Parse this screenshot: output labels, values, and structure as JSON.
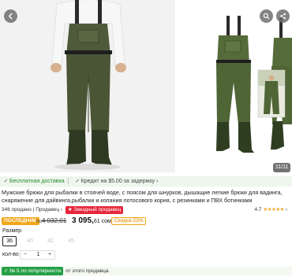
{
  "gallery": {
    "counter": "11/11",
    "back_icon": "chevron-left-icon",
    "search_icon": "search-icon",
    "share_icon": "share-icon"
  },
  "delivery": {
    "free_label": "Бесплатная доставка",
    "guarantee_label": "Кредит на $5.00 за задержку"
  },
  "product": {
    "title": "Мужские брюки для рыбалки в стоячей воде, с поясом для шнурков, дышащие легкие брюки для вадинга, снаряжение для дайвинга,рыбалки и копания лотосового корня, с резинками и ПВХ ботинками",
    "sold": "346 продано",
    "seller_prefix": "Продавец",
    "seller_badge": "Звездный продавец",
    "rating_value": "4.7",
    "rating_stars": "★★★★★"
  },
  "price": {
    "last_badge": "ПОСЛЕДНИЕ",
    "old_prefix": "по",
    "old_price": "4 032,01",
    "new_price_main": "3 095,",
    "new_price_cents": "61 ",
    "currency": "сом",
    "discount": "Скидка 23%"
  },
  "size": {
    "label": "Размер",
    "options": [
      "36",
      "40",
      "42",
      "45"
    ],
    "selected": "36"
  },
  "quantity": {
    "label": "кол-во",
    "minus": "−",
    "value": "1",
    "plus": "+"
  },
  "popular": {
    "badge": "№ 5 по популярности",
    "text": "от этого продавца"
  }
}
